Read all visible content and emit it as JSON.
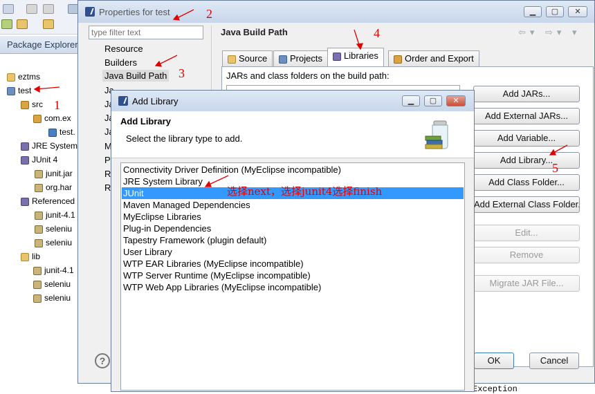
{
  "eclipse": {
    "package_explorer_tab": "Package Explorer",
    "tree": [
      {
        "label": "eztms",
        "icon": "folder-project-icon"
      },
      {
        "label": "test",
        "icon": "java-project-icon"
      },
      {
        "label": "src",
        "icon": "source-folder-icon"
      },
      {
        "label": "com.ex",
        "icon": "package-icon"
      },
      {
        "label": "test.",
        "icon": "java-file-icon"
      },
      {
        "label": "JRE System",
        "icon": "library-icon"
      },
      {
        "label": "JUnit 4",
        "icon": "library-icon"
      },
      {
        "label": "junit.jar",
        "icon": "jar-icon"
      },
      {
        "label": "org.har",
        "icon": "jar-icon"
      },
      {
        "label": "Referenced",
        "icon": "library-icon"
      },
      {
        "label": "junit-4.1",
        "icon": "jar-icon"
      },
      {
        "label": "seleniu",
        "icon": "jar-icon"
      },
      {
        "label": "seleniu",
        "icon": "jar-icon"
      },
      {
        "label": "lib",
        "icon": "folder-icon"
      },
      {
        "label": "junit-4.1",
        "icon": "jar-icon"
      },
      {
        "label": "seleniu",
        "icon": "jar-icon"
      },
      {
        "label": "seleniu",
        "icon": "jar-icon"
      }
    ]
  },
  "properties": {
    "title": "Properties for test",
    "filter_placeholder": "type filter text",
    "nav": [
      "Resource",
      "Builders",
      "Java Build Path",
      "Ja",
      "Ja",
      "Ja",
      "Ja",
      "M",
      "P",
      "R",
      "R"
    ],
    "page_title": "Java Build Path",
    "tabs": [
      "Source",
      "Projects",
      "Libraries",
      "Order and Export"
    ],
    "active_tab": "Libraries",
    "jars_label": "JARs and class folders on the build path:",
    "buttons": [
      "Add JARs...",
      "Add External JARs...",
      "Add Variable...",
      "Add Library...",
      "Add Class Folder...",
      "Add External Class Folder...",
      "Edit...",
      "Remove",
      "Migrate JAR File..."
    ],
    "ok": "OK",
    "cancel": "Cancel",
    "exception_text": "Exception"
  },
  "add_library": {
    "title": "Add Library",
    "heading": "Add Library",
    "subtitle": "Select the library type to add.",
    "items": [
      "Connectivity Driver Definition (MyEclipse incompatible)",
      "JRE System Library",
      "JUnit",
      "Maven Managed Dependencies",
      "MyEclipse Libraries",
      "Plug-in Dependencies",
      "Tapestry Framework (plugin default)",
      "User Library",
      "WTP EAR Libraries (MyEclipse incompatible)",
      "WTP Server Runtime (MyEclipse incompatible)",
      "WTP Web App Libraries (MyEclipse incompatible)"
    ],
    "selected": "JUnit"
  },
  "annotations": {
    "n1": "1",
    "n2": "2",
    "n3": "3",
    "n4": "4",
    "n5": "5",
    "instruction": "选择next，选择junit4选择finish"
  },
  "colors": {
    "selection": "#3399ff",
    "annotation": "#e00000",
    "title_bar": "#c7d6ea"
  }
}
